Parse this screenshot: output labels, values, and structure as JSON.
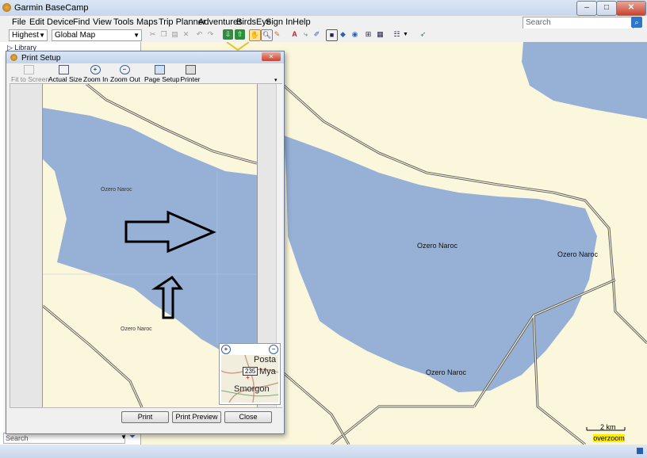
{
  "app": {
    "title": "Garmin BaseCamp",
    "window_buttons": {
      "minimize": "–",
      "maximize": "□",
      "close": "✕"
    }
  },
  "menu": [
    "File",
    "Edit",
    "Device",
    "Find",
    "View",
    "Tools",
    "Maps",
    "Trip Planner",
    "Adventures",
    "BirdsEye",
    "Sign In",
    "Help"
  ],
  "search": {
    "placeholder": "Search"
  },
  "toolbar": {
    "detail_value": "Highest",
    "map_value": "Global Map"
  },
  "library": {
    "label": "Library",
    "search_placeholder": "Search"
  },
  "map": {
    "labels": [
      "Ozero Naroc",
      "Ozero Naroc",
      "Ozero Naroc"
    ],
    "scale": "2 km",
    "overzoom": "overzoom",
    "colors": {
      "land": "#fbf7dc",
      "water": "#97b0d6",
      "road": "#555555"
    }
  },
  "dialog": {
    "title": "Print Setup",
    "toolbar": [
      {
        "label": "Fit to Screen",
        "icon": "fit-to-screen-icon",
        "disabled": true
      },
      {
        "label": "Actual Size",
        "icon": "actual-size-icon"
      },
      {
        "label": "Zoom In",
        "icon": "zoom-in-icon"
      },
      {
        "label": "Zoom Out",
        "icon": "zoom-out-icon"
      },
      {
        "label": "Page Setup",
        "icon": "page-setup-icon"
      },
      {
        "label": "Printer",
        "icon": "printer-icon"
      }
    ],
    "preview_labels": [
      "Ozero Naroc",
      "Ozero Naroc"
    ],
    "overview": {
      "road_number": "235",
      "labels": [
        "Posta",
        "Mya",
        "Smorgon"
      ]
    },
    "buttons": {
      "print": "Print",
      "print_preview": "Print Preview",
      "close": "Close"
    }
  }
}
